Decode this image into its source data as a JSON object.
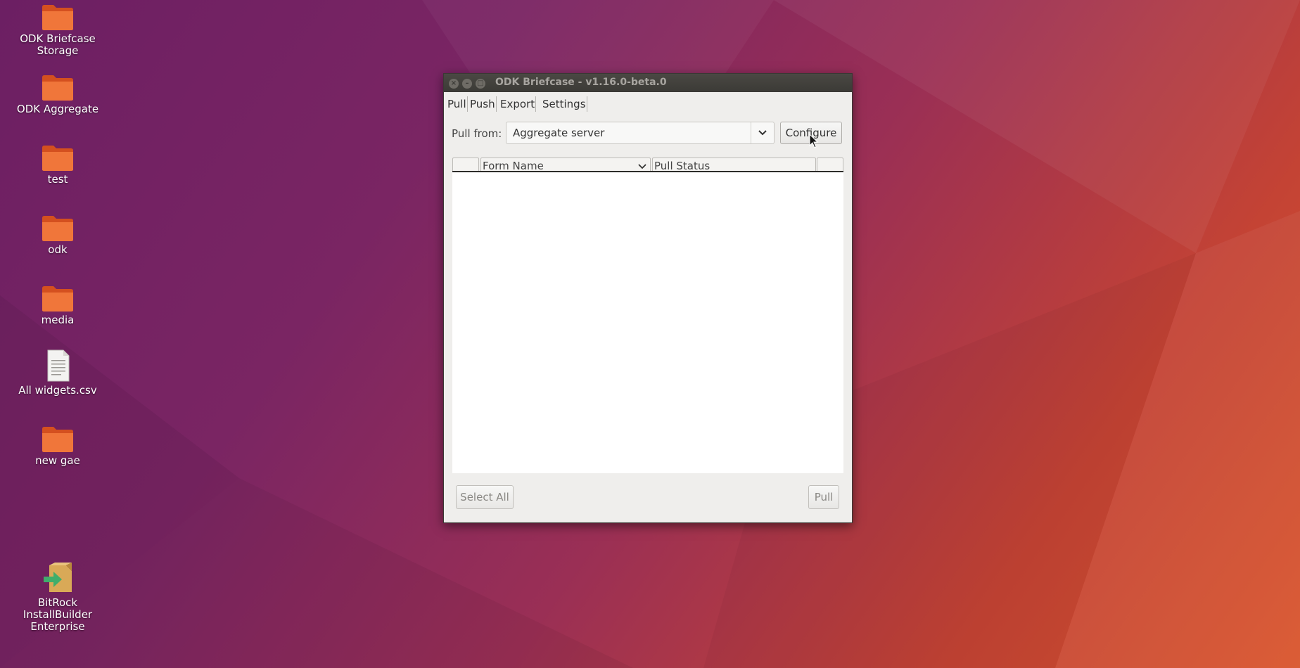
{
  "desktop": {
    "icons": [
      {
        "label": "ODK Briefcase Storage",
        "icon": "folder-icon"
      },
      {
        "label": "ODK Aggregate",
        "icon": "folder-icon"
      },
      {
        "label": "test",
        "icon": "folder-icon"
      },
      {
        "label": "odk",
        "icon": "folder-icon"
      },
      {
        "label": "media",
        "icon": "folder-icon"
      },
      {
        "label": "All widgets.csv",
        "icon": "spreadsheet-file-icon"
      },
      {
        "label": "new gae",
        "icon": "folder-icon"
      },
      {
        "label": "BitRock InstallBuilder Enterprise",
        "icon": "installer-icon"
      }
    ]
  },
  "window": {
    "title": "ODK Briefcase - v1.16.0-beta.0",
    "controls": {
      "close": "×",
      "minimize": "–",
      "maximize": "□"
    },
    "tabs": [
      {
        "label": "Pull"
      },
      {
        "label": "Push"
      },
      {
        "label": "Export"
      },
      {
        "label": "Settings"
      }
    ],
    "pull_from_label": "Pull from:",
    "source_value": "Aggregate server",
    "configure_label": "Configure",
    "table": {
      "columns": [
        "",
        "Form Name",
        "Pull Status",
        ""
      ],
      "rows": []
    },
    "select_all_label": "Select All",
    "pull_label": "Pull"
  },
  "colors": {
    "folder": "#e8692c",
    "titlebar": "#3b3a36",
    "window_bg": "#efeeec"
  }
}
